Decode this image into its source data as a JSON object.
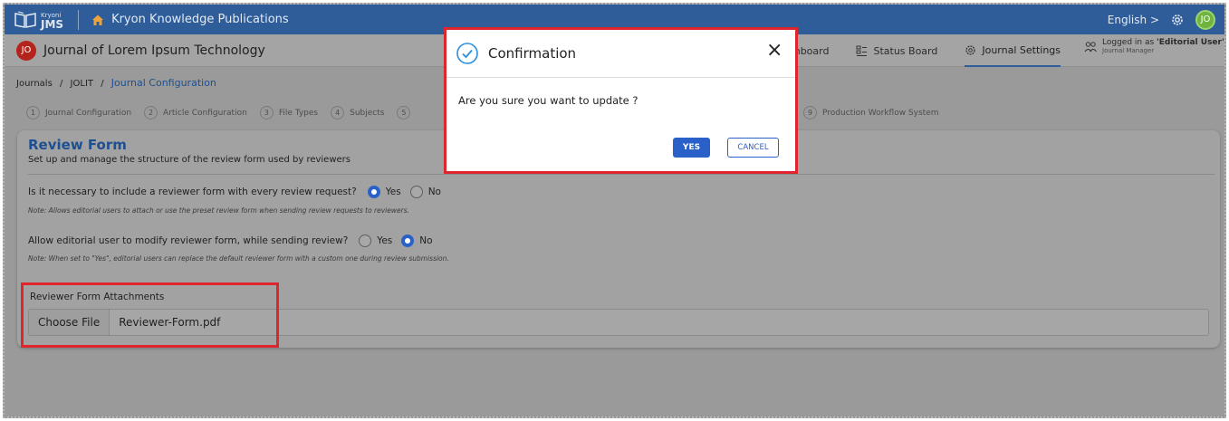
{
  "app": {
    "logo_small": "Kryoni",
    "logo_big": "JMS",
    "publisher": "Kryon Knowledge Publications",
    "language": "English",
    "language_chevron": ">",
    "user_initials": "JO"
  },
  "journal": {
    "initials": "JO",
    "title": "Journal of Lorem Ipsum Technology",
    "nav": [
      {
        "label": "shboard",
        "icon": "dashboard-icon"
      },
      {
        "label": "Status Board",
        "icon": "status-board-icon"
      },
      {
        "label": "Journal Settings",
        "icon": "settings-icon",
        "active": true
      }
    ],
    "user_line_prefix": "Logged in as ",
    "user_line_name": "'Editorial User'",
    "user_role": "Journal Manager"
  },
  "breadcrumb": {
    "items": [
      "Journals",
      "JOLIT",
      "Journal Configuration"
    ],
    "sep": "/"
  },
  "steps": [
    {
      "num": "1",
      "label": "Journal Configuration"
    },
    {
      "num": "2",
      "label": "Article Configuration"
    },
    {
      "num": "3",
      "label": "File Types"
    },
    {
      "num": "4",
      "label": "Subjects"
    },
    {
      "num": "5",
      "label": ""
    },
    {
      "num": "9",
      "label": "Production Workflow System"
    }
  ],
  "review_form": {
    "title": "Review Form",
    "subtitle": "Set up and manage the structure of the review form used by reviewers",
    "q1": {
      "question": "Is it necessary to include a reviewer form with every review request?",
      "yes": "Yes",
      "no": "No",
      "selected": "Yes",
      "note": "Note: Allows editorial users to attach or use the preset review form when sending review requests to reviewers."
    },
    "q2": {
      "question": "Allow editorial user to modify reviewer form, while sending review?",
      "yes": "Yes",
      "no": "No",
      "selected": "No",
      "note": "Note: When set to \"Yes\", editorial users can replace the default reviewer form with a custom one during review submission."
    },
    "attachments_label": "Reviewer Form Attachments",
    "choose_file": "Choose File",
    "file_name": "Reviewer-Form.pdf"
  },
  "modal": {
    "title": "Confirmation",
    "message": "Are you sure you want to update ?",
    "yes": "YES",
    "cancel": "CANCEL",
    "close": "×"
  },
  "colors": {
    "primary": "#2e5d9a",
    "accent_button": "#2a61c9",
    "highlight": "#e0262d",
    "avatar_journal": "#b5241c",
    "avatar_user": "#6fb43f"
  }
}
